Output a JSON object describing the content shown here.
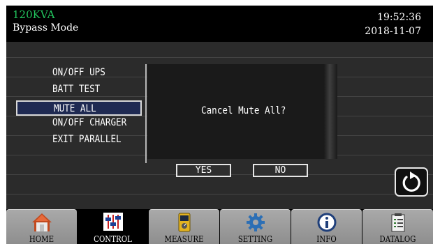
{
  "header": {
    "model": "120KVA",
    "mode": "Bypass Mode",
    "time": "19:52:36",
    "date": "2018-11-07"
  },
  "menu": {
    "items": [
      "ON/OFF UPS",
      "BATT TEST",
      "MUTE ALL",
      "ON/OFF CHARGER",
      "EXIT PARALLEL"
    ],
    "selected": "MUTE ALL"
  },
  "dialog": {
    "message": "Cancel Mute All?",
    "yes_label": "YES",
    "no_label": "NO"
  },
  "back_button": {
    "icon": "refresh-back-icon"
  },
  "nav": {
    "active": "CONTROL",
    "tabs": [
      {
        "label": "HOME",
        "icon": "home-icon"
      },
      {
        "label": "CONTROL",
        "icon": "sliders-icon"
      },
      {
        "label": "MEASURE",
        "icon": "meter-icon"
      },
      {
        "label": "SETTING",
        "icon": "gear-icon"
      },
      {
        "label": "INFO",
        "icon": "info-icon"
      },
      {
        "label": "DATALOG",
        "icon": "clipboard-log-icon"
      }
    ]
  },
  "colors": {
    "model_text": "#22c55e",
    "selected_item_bg": "#1f2a52",
    "screen_bg": "#000000"
  }
}
